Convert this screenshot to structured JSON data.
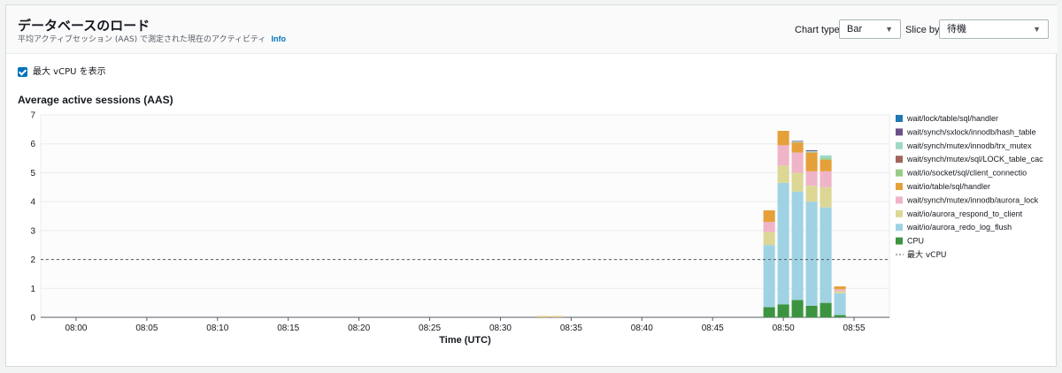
{
  "header": {
    "title": "データベースのロード",
    "subtitle": "平均アクティブセッション (AAS) で測定された現在のアクティビティ",
    "info_link": "Info"
  },
  "controls": {
    "chart_type_label": "Chart type",
    "chart_type_value": "Bar",
    "slice_by_label": "Slice by",
    "slice_by_value": "待機"
  },
  "options": {
    "show_max_vcpu_label": "最大 vCPU を表示",
    "show_max_vcpu_checked": true
  },
  "chart_data": {
    "type": "bar",
    "stacked": true,
    "title": "Average active sessions (AAS)",
    "xlabel": "Time (UTC)",
    "ylabel": "",
    "ylim": [
      0,
      7
    ],
    "yticks": [
      0,
      1,
      2,
      3,
      4,
      5,
      6,
      7
    ],
    "xticks": [
      "08:00",
      "08:05",
      "08:10",
      "08:15",
      "08:20",
      "08:25",
      "08:30",
      "08:35",
      "08:40",
      "08:45",
      "08:50",
      "08:55"
    ],
    "xrange_minutes": [
      -2.5,
      57.5
    ],
    "grid": true,
    "legend_position": "right",
    "max_vcpu": {
      "label": "最大 vCPU",
      "value": 2
    },
    "series": [
      {
        "name": "wait/lock/table/sql/handler",
        "color": "#1f77b4"
      },
      {
        "name": "wait/synch/sxlock/innodb/hash_table",
        "color": "#6b4f8a"
      },
      {
        "name": "wait/synch/mutex/innodb/trx_mutex",
        "color": "#9fd8c4"
      },
      {
        "name": "wait/synch/mutex/sql/LOCK_table_cac",
        "color": "#a3645f"
      },
      {
        "name": "wait/io/socket/sql/client_connectio",
        "color": "#98cc86"
      },
      {
        "name": "wait/io/table/sql/handler",
        "color": "#e5a03a"
      },
      {
        "name": "wait/synch/mutex/innodb/aurora_lock",
        "color": "#f0b4c8"
      },
      {
        "name": "wait/io/aurora_respond_to_client",
        "color": "#dcd795"
      },
      {
        "name": "wait/io/aurora_redo_log_flush",
        "color": "#9fd3e3"
      },
      {
        "name": "CPU",
        "color": "#3d9440"
      }
    ],
    "bars": [
      {
        "minute": 33,
        "values": {
          "wait/io/table/sql/handler": 0.02,
          "wait/io/aurora_respond_to_client": 0.02
        }
      },
      {
        "minute": 34,
        "values": {
          "wait/io/table/sql/handler": 0.02,
          "wait/io/aurora_respond_to_client": 0.02
        }
      },
      {
        "minute": 49,
        "values": {
          "CPU": 0.35,
          "wait/io/aurora_redo_log_flush": 2.15,
          "wait/io/aurora_respond_to_client": 0.45,
          "wait/synch/mutex/innodb/aurora_lock": 0.35,
          "wait/io/table/sql/handler": 0.4
        }
      },
      {
        "minute": 50,
        "values": {
          "CPU": 0.45,
          "wait/io/aurora_redo_log_flush": 4.2,
          "wait/io/aurora_respond_to_client": 0.6,
          "wait/synch/mutex/innodb/aurora_lock": 0.7,
          "wait/io/table/sql/handler": 0.5
        }
      },
      {
        "minute": 51,
        "values": {
          "CPU": 0.6,
          "wait/io/aurora_redo_log_flush": 3.75,
          "wait/io/aurora_respond_to_client": 0.65,
          "wait/synch/mutex/innodb/aurora_lock": 0.7,
          "wait/io/table/sql/handler": 0.35,
          "wait/synch/mutex/innodb/trx_mutex": 0.03,
          "wait/synch/sxlock/innodb/hash_table": 0.02
        }
      },
      {
        "minute": 52,
        "values": {
          "CPU": 0.4,
          "wait/io/aurora_redo_log_flush": 3.6,
          "wait/io/aurora_respond_to_client": 0.55,
          "wait/synch/mutex/innodb/aurora_lock": 0.5,
          "wait/io/table/sql/handler": 0.65,
          "wait/synch/mutex/innodb/trx_mutex": 0.05,
          "wait/synch/sxlock/innodb/hash_table": 0.03
        }
      },
      {
        "minute": 53,
        "values": {
          "CPU": 0.5,
          "wait/io/aurora_redo_log_flush": 3.3,
          "wait/io/aurora_respond_to_client": 0.7,
          "wait/synch/mutex/innodb/aurora_lock": 0.55,
          "wait/io/table/sql/handler": 0.4,
          "wait/synch/mutex/innodb/trx_mutex": 0.1,
          "wait/io/socket/sql/client_connectio": 0.05
        }
      },
      {
        "minute": 54,
        "values": {
          "CPU": 0.08,
          "wait/io/aurora_redo_log_flush": 0.75,
          "wait/io/aurora_respond_to_client": 0.07,
          "wait/synch/mutex/innodb/aurora_lock": 0.07,
          "wait/io/table/sql/handler": 0.1
        }
      }
    ]
  }
}
